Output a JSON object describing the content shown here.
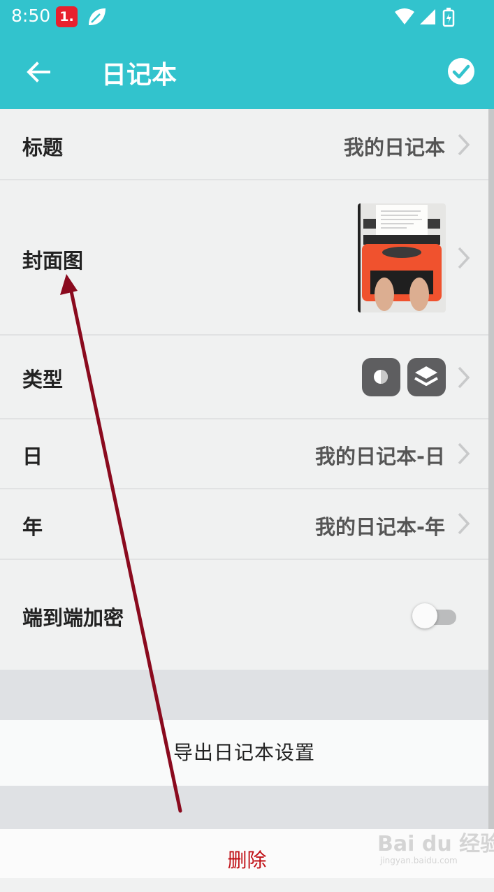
{
  "status_bar": {
    "time": "8:50",
    "notification_badge": "1.",
    "icons": [
      "leaf-icon",
      "wifi-icon",
      "signal-icon",
      "battery-icon"
    ]
  },
  "app_bar": {
    "title": "日记本",
    "back_icon": "arrow-left-icon",
    "confirm_icon": "check-circle-icon"
  },
  "settings": {
    "title_row": {
      "label": "标题",
      "value": "我的日记本"
    },
    "cover_row": {
      "label": "封面图",
      "image": "typewriter-photo"
    },
    "type_row": {
      "label": "类型",
      "icons": [
        "toggle-style-icon",
        "layers-icon"
      ]
    },
    "day_row": {
      "label": "日",
      "value": "我的日记本-日"
    },
    "year_row": {
      "label": "年",
      "value": "我的日记本-年"
    },
    "encryption_row": {
      "label": "端到端加密",
      "enabled": false
    }
  },
  "actions": {
    "export_label": "导出日记本设置",
    "delete_label": "删除"
  },
  "watermark": {
    "text": "Bai du 经验",
    "sub": "jingyan.baidu.com"
  },
  "colors": {
    "accent": "#32c3cd",
    "delete": "#c01016",
    "annotation_arrow": "#8a0a1e"
  }
}
